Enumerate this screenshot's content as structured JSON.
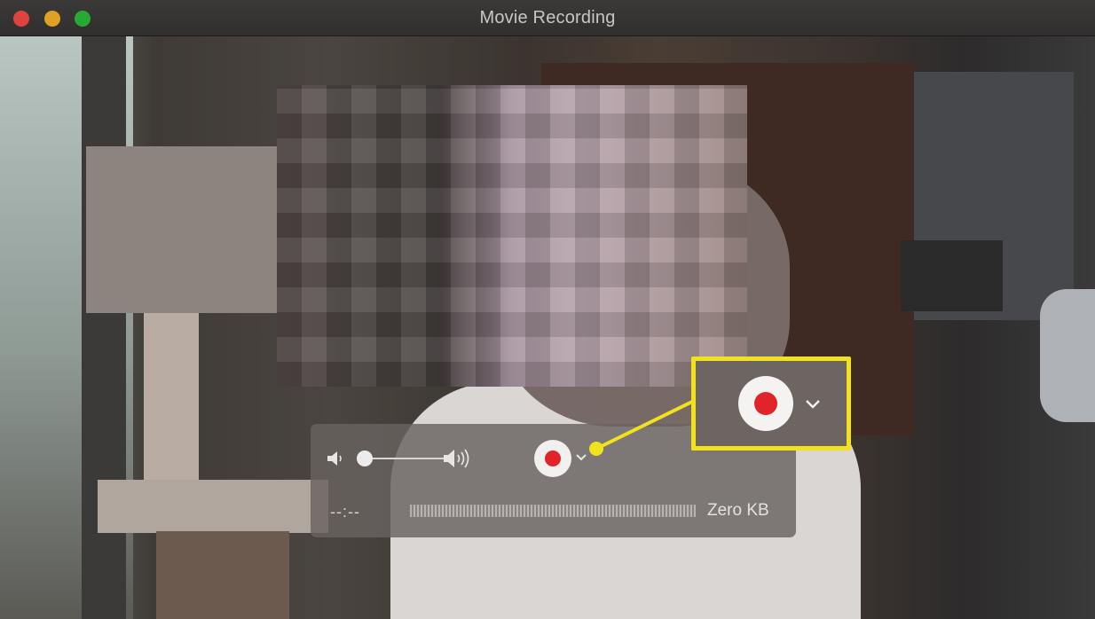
{
  "window": {
    "title": "Movie Recording"
  },
  "controls": {
    "elapsed_time": "--:--",
    "file_size": "Zero KB",
    "volume_level": 0.0
  },
  "icons": {
    "volume_low": "speaker-low-icon",
    "volume_high": "speaker-high-icon",
    "record": "record-icon",
    "options": "chevron-down-icon"
  },
  "colors": {
    "record_red": "#e0242a",
    "highlight_yellow": "#f2e21c",
    "close": "#e0443e",
    "minimize": "#dea123",
    "zoom": "#27aa35"
  }
}
